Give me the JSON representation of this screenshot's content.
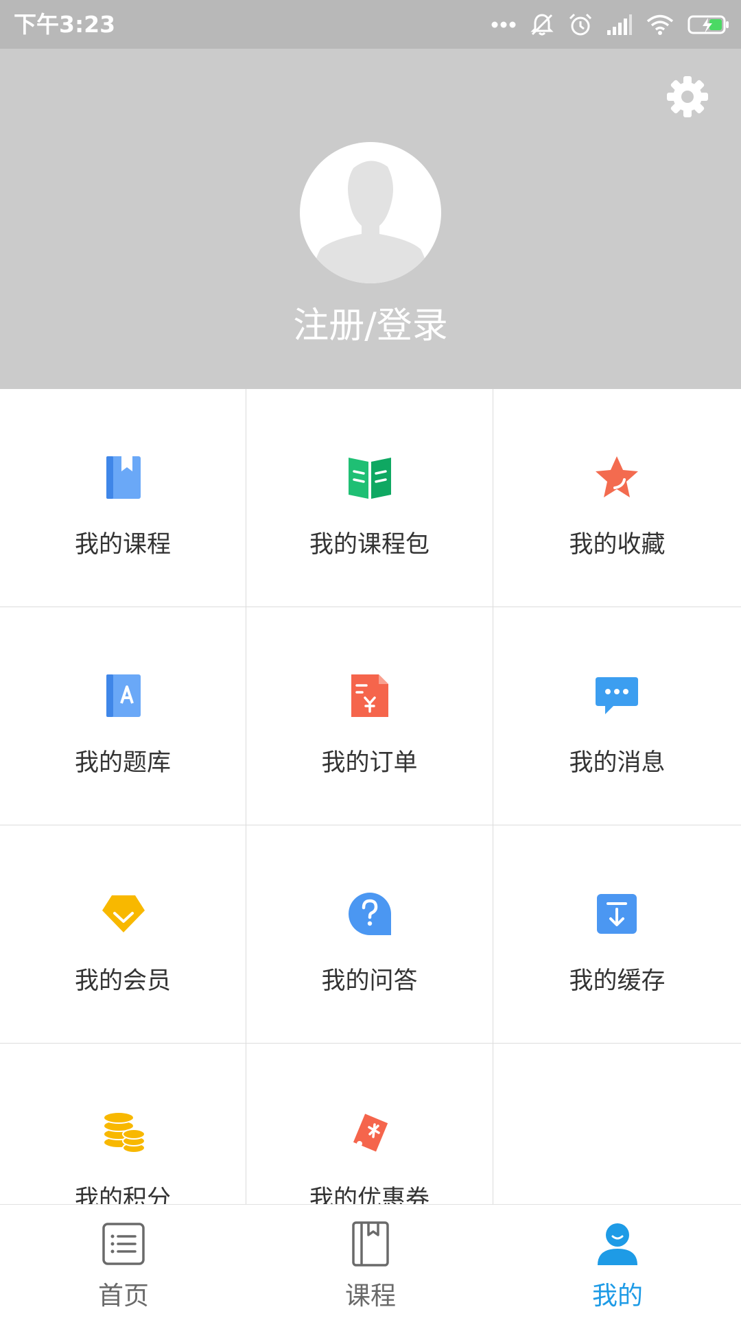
{
  "status_bar": {
    "time": "下午3:23"
  },
  "header": {
    "login_label": "注册/登录"
  },
  "menu": {
    "items": [
      {
        "label": "我的课程",
        "icon": "course-book-icon"
      },
      {
        "label": "我的课程包",
        "icon": "course-package-icon"
      },
      {
        "label": "我的收藏",
        "icon": "star-icon"
      },
      {
        "label": "我的题库",
        "icon": "question-bank-icon"
      },
      {
        "label": "我的订单",
        "icon": "order-icon"
      },
      {
        "label": "我的消息",
        "icon": "message-icon"
      },
      {
        "label": "我的会员",
        "icon": "vip-gem-icon"
      },
      {
        "label": "我的问答",
        "icon": "qa-icon"
      },
      {
        "label": "我的缓存",
        "icon": "download-icon"
      },
      {
        "label": "我的积分",
        "icon": "coins-icon"
      },
      {
        "label": "我的优惠券",
        "icon": "coupon-icon"
      }
    ]
  },
  "tabbar": {
    "tabs": [
      {
        "label": "首页",
        "icon": "home-list-icon",
        "active": false
      },
      {
        "label": "课程",
        "icon": "course-book-icon",
        "active": false
      },
      {
        "label": "我的",
        "icon": "profile-icon",
        "active": true
      }
    ]
  },
  "colors": {
    "accent": "#1e9be6",
    "header_bg": "#cbcbcb",
    "status_bg": "#b8b8b8"
  }
}
